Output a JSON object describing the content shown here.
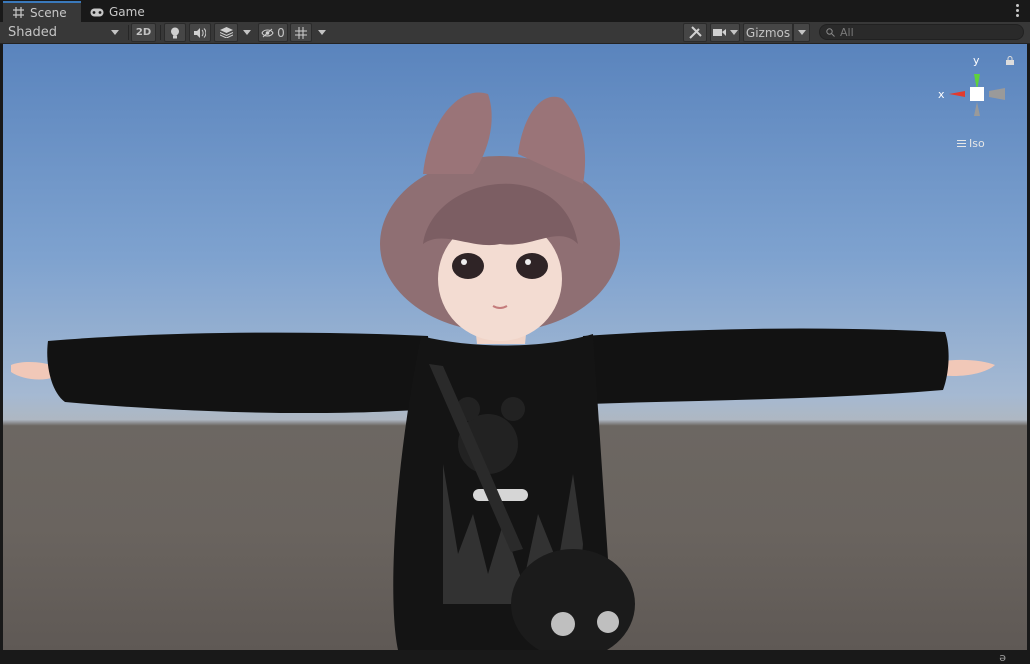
{
  "tabs": [
    {
      "label": "Scene",
      "icon": "grid-icon",
      "active": true
    },
    {
      "label": "Game",
      "icon": "gamepad-icon",
      "active": false
    }
  ],
  "toolbar": {
    "shading_mode": "Shaded",
    "toggle_2d": "2D",
    "hidden_count": "0",
    "gizmos_label": "Gizmos",
    "search_placeholder": "All"
  },
  "viewport": {
    "axis_x": "x",
    "axis_y": "y",
    "projection": "Iso",
    "colors": {
      "sky_top": "#5a84bd",
      "horizon": "#aeb7c2",
      "ground": "#6a645f",
      "axis_x": "#e23b2e",
      "axis_y": "#5fd23a",
      "accent_tab": "#3a79bb"
    }
  }
}
